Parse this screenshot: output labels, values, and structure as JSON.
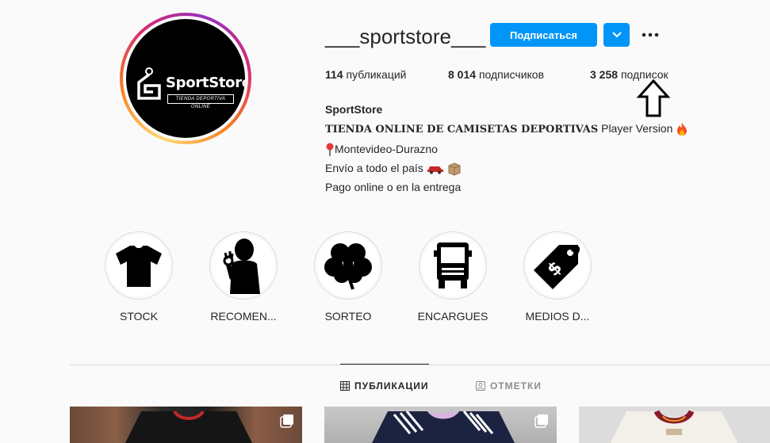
{
  "profile": {
    "username": "___sportstore___",
    "avatar_brand": "SportStore",
    "avatar_tagline": "TIENDA DEPORTIVA ONLINE",
    "follow_label": "Подписаться",
    "stats": {
      "posts_count": "114",
      "posts_label": "публикаций",
      "followers_count": "8 014",
      "followers_label": "подписчиков",
      "following_count": "3 258",
      "following_label": "подписок"
    },
    "bio": {
      "name": "SportStore",
      "line1_bold": "TIENDA ONLINE DE CAMISETAS DEPORTIVAS",
      "line1_rest": "Player Version",
      "line2": "Montevideo-Durazno",
      "line3": "Envío a todo el país",
      "line4": "Pago online o en la entrega"
    }
  },
  "highlights": [
    {
      "label": "STOCK",
      "icon": "tshirt-icon"
    },
    {
      "label": "RECOMEN...",
      "icon": "ok-hand-person-icon"
    },
    {
      "label": "SORTEO",
      "icon": "clover-icon"
    },
    {
      "label": "ENCARGUES",
      "icon": "truck-icon"
    },
    {
      "label": "MEDIOS D...",
      "icon": "price-tag-icon"
    }
  ],
  "tabs": {
    "posts": "ПУБЛИКАЦИИ",
    "tagged": "ОТМЕТКИ"
  },
  "colors": {
    "accent": "#0095f6",
    "text": "#262626",
    "muted": "#8e8e8e",
    "border": "#dbdbdb",
    "background": "#fafafa"
  }
}
